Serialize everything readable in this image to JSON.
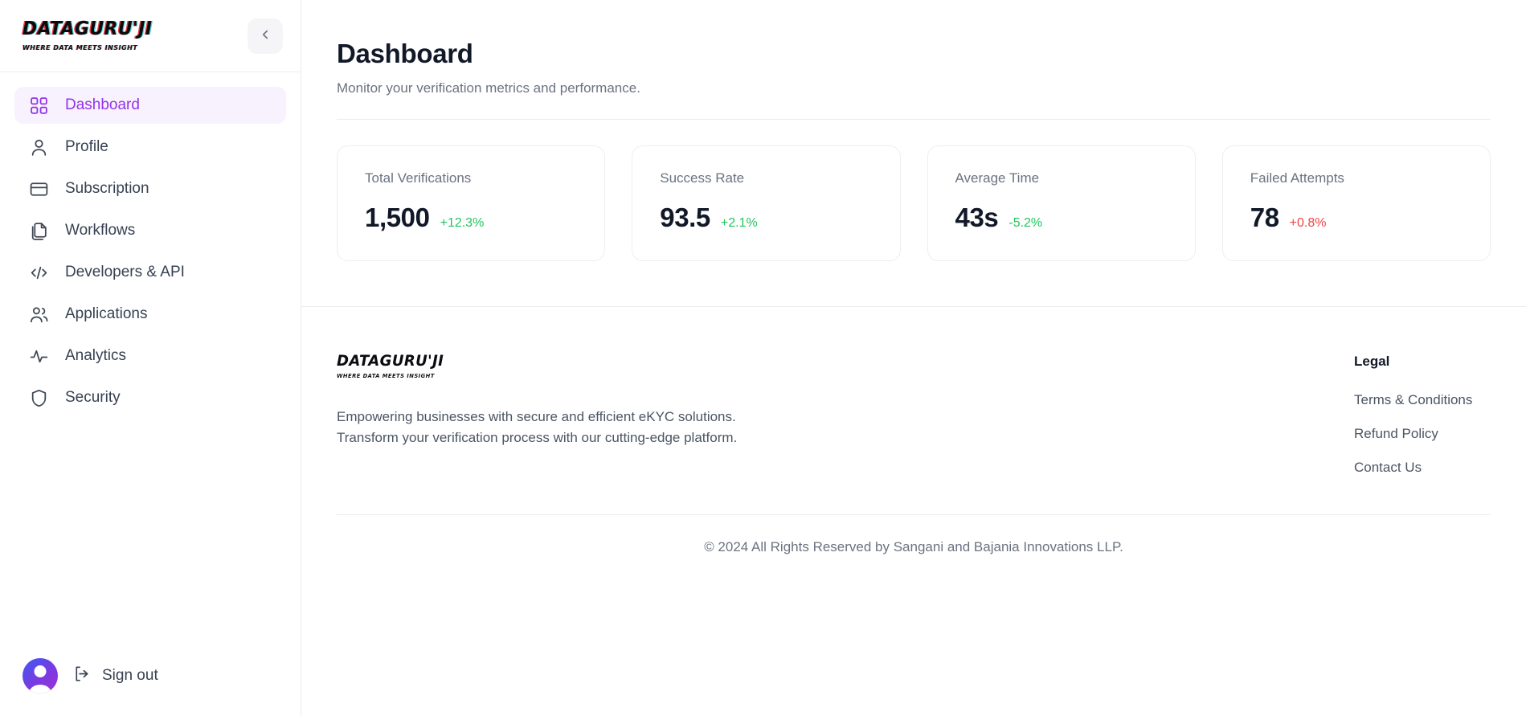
{
  "brand": {
    "logo_main": "DATAGURU'JI",
    "logo_sub": "WHERE DATA MEETS INSIGHT",
    "accent_purple": "#9333ea",
    "accent_purple_bg": "#f8f1fe",
    "positive_green": "#22c55e",
    "negative_red": "#ef4444"
  },
  "sidebar": {
    "collapse_icon": "chevron-left-icon",
    "items": [
      {
        "label": "Dashboard",
        "icon": "grid-icon",
        "active": true
      },
      {
        "label": "Profile",
        "icon": "user-icon",
        "active": false
      },
      {
        "label": "Subscription",
        "icon": "credit-card-icon",
        "active": false
      },
      {
        "label": "Workflows",
        "icon": "copy-files-icon",
        "active": false
      },
      {
        "label": "Developers & API",
        "icon": "code-icon",
        "active": false
      },
      {
        "label": "Applications",
        "icon": "users-icon",
        "active": false
      },
      {
        "label": "Analytics",
        "icon": "activity-icon",
        "active": false
      },
      {
        "label": "Security",
        "icon": "shield-icon",
        "active": false
      }
    ],
    "signout_label": "Sign out",
    "signout_icon": "logout-icon",
    "avatar_icon": "user-avatar"
  },
  "page": {
    "title": "Dashboard",
    "subtitle": "Monitor your verification metrics and performance."
  },
  "stats": [
    {
      "label": "Total Verifications",
      "value": "1,500",
      "delta": "+12.3%",
      "delta_kind": "up"
    },
    {
      "label": "Success Rate",
      "value": "93.5",
      "delta": "+2.1%",
      "delta_kind": "up"
    },
    {
      "label": "Average Time",
      "value": "43s",
      "delta": "-5.2%",
      "delta_kind": "down"
    },
    {
      "label": "Failed Attempts",
      "value": "78",
      "delta": "+0.8%",
      "delta_kind": "bad"
    }
  ],
  "footer": {
    "logo_main": "DATAGURU'JI",
    "logo_sub": "WHERE DATA MEETS INSIGHT",
    "description_line1": "Empowering businesses with secure and efficient eKYC solutions.",
    "description_line2": "Transform your verification process with our cutting-edge platform.",
    "legal_title": "Legal",
    "legal_links": [
      {
        "label": "Terms & Conditions"
      },
      {
        "label": "Refund Policy"
      },
      {
        "label": "Contact Us"
      }
    ],
    "copyright": "© 2024 All Rights Reserved by Sangani and Bajania Innovations LLP."
  }
}
